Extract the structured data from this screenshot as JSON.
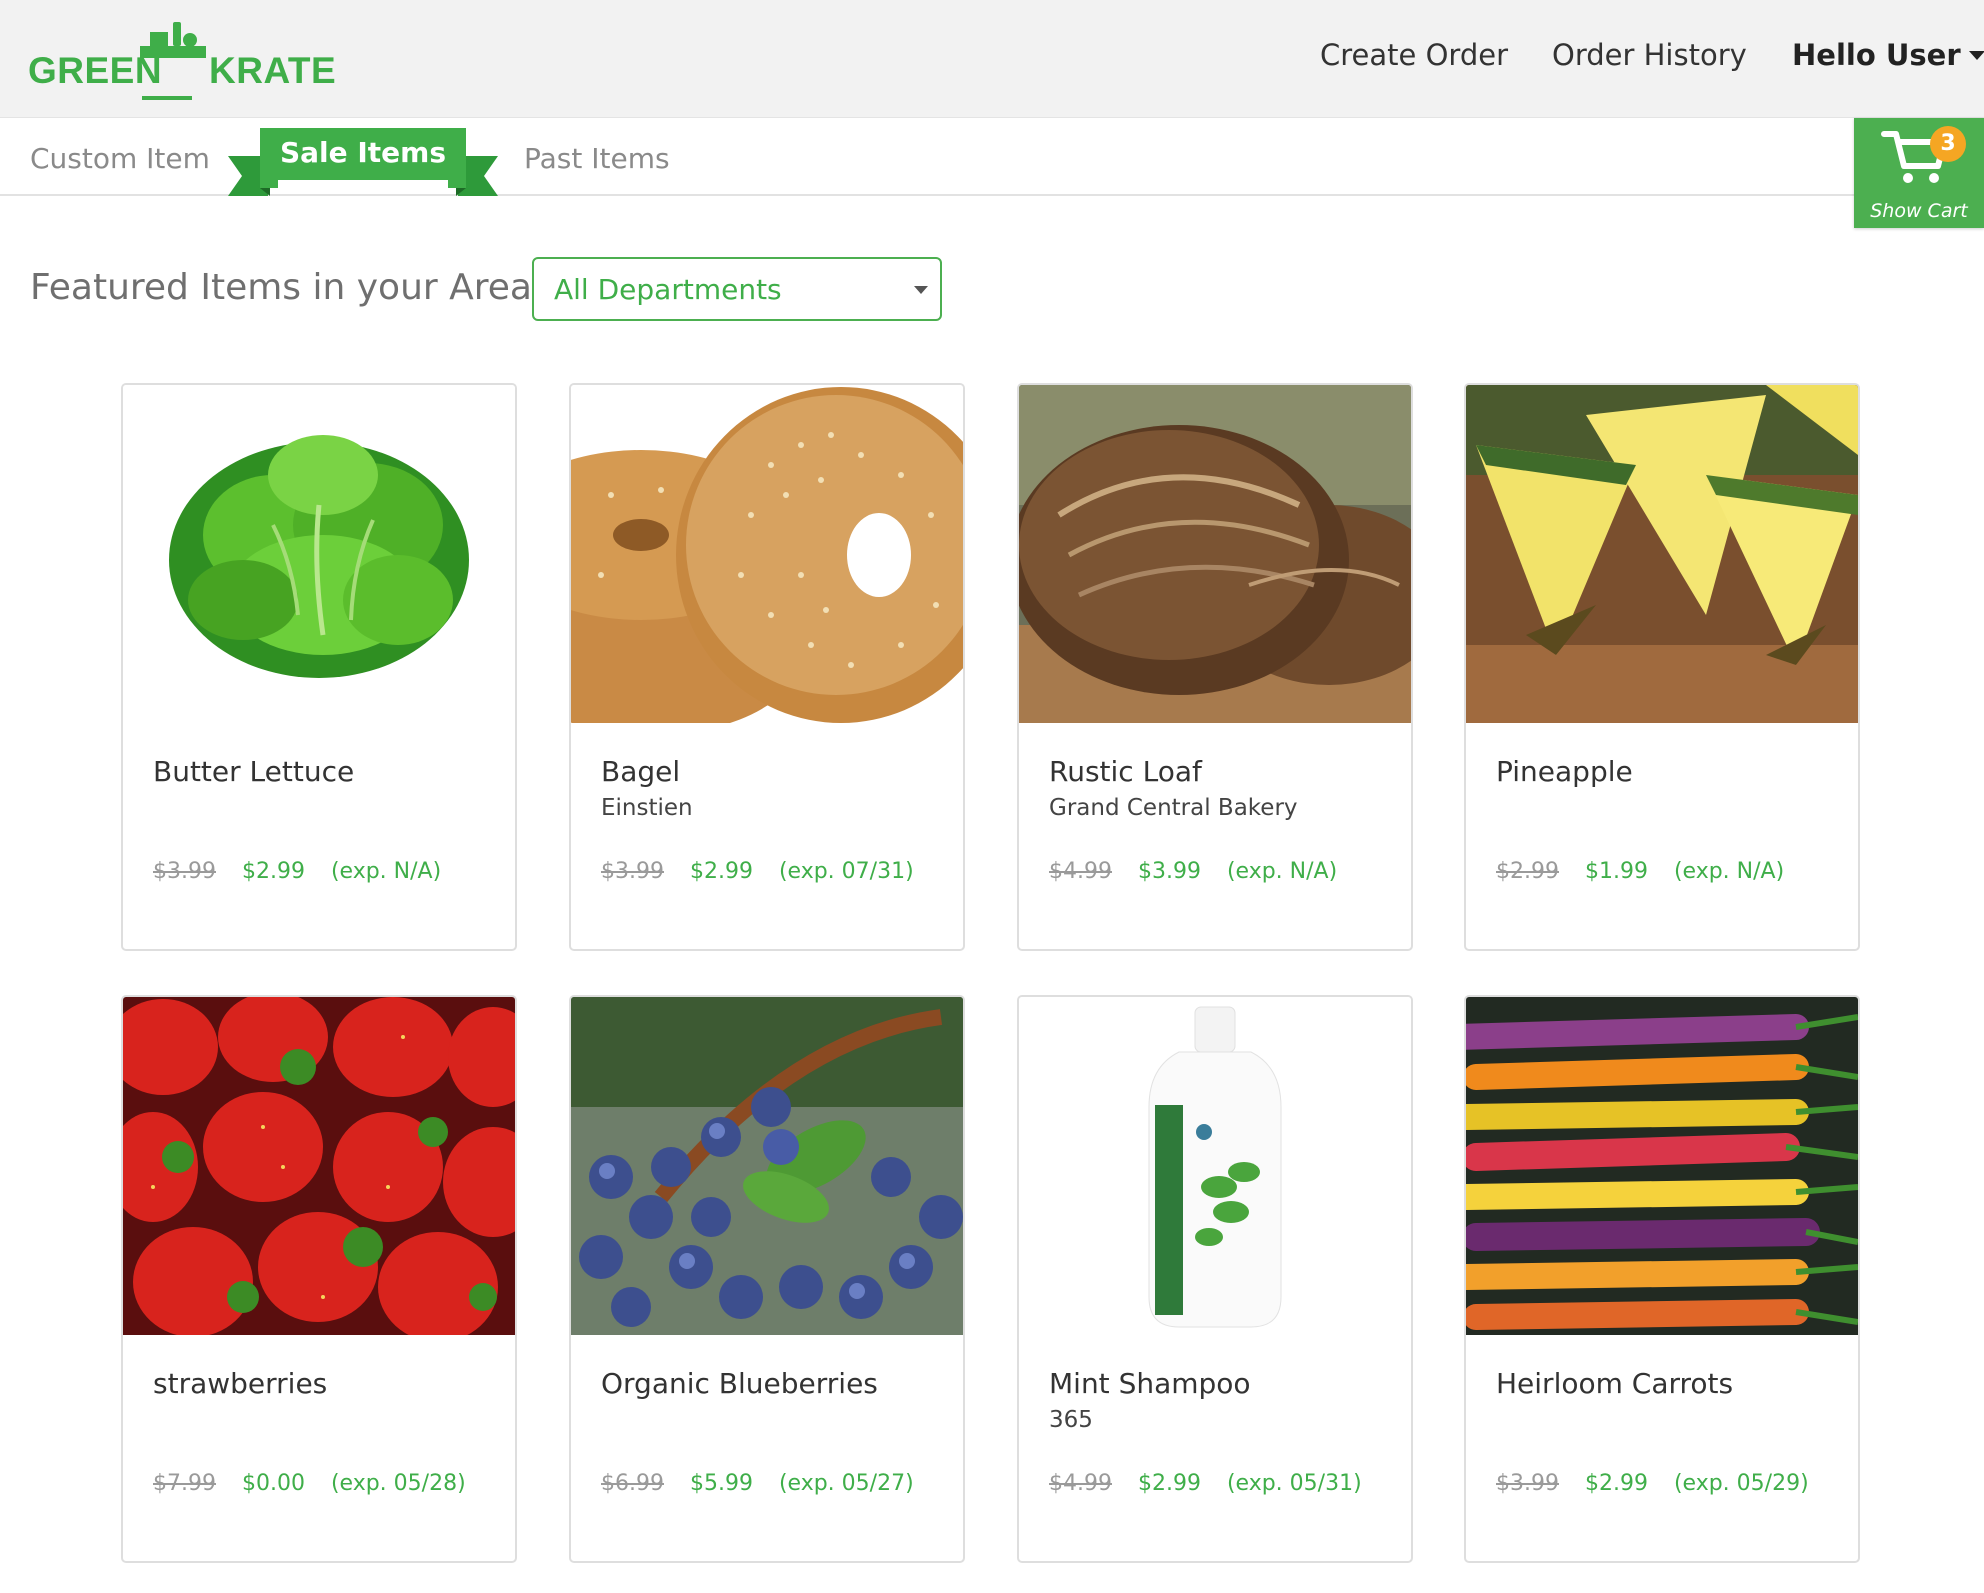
{
  "brand": {
    "logo_left": "GREEN",
    "logo_right": "KRATE"
  },
  "header": {
    "nav": {
      "create_order": "Create Order",
      "order_history": "Order History",
      "user": "Hello User"
    }
  },
  "tabs": {
    "custom": "Custom Item",
    "sale": "Sale Items",
    "past": "Past Items"
  },
  "cart": {
    "count": "3",
    "label": "Show Cart"
  },
  "main": {
    "section_title": "Featured Items in your Area",
    "department_selected": "All Departments"
  },
  "colors": {
    "brand_green": "#3fae49",
    "cart_bg": "#4caf50",
    "badge": "#f5a623"
  },
  "products": [
    {
      "name": "Butter Lettuce",
      "brand": "",
      "old_price": "$3.99",
      "new_price": "$2.99",
      "exp": "(exp. N/A)",
      "image": "lettuce-photo"
    },
    {
      "name": "Bagel",
      "brand": "Einstien",
      "old_price": "$3.99",
      "new_price": "$2.99",
      "exp": "(exp. 07/31)",
      "image": "bagel-photo"
    },
    {
      "name": "Rustic Loaf",
      "brand": "Grand Central Bakery",
      "old_price": "$4.99",
      "new_price": "$3.99",
      "exp": "(exp. N/A)",
      "image": "bread-photo"
    },
    {
      "name": "Pineapple",
      "brand": "",
      "old_price": "$2.99",
      "new_price": "$1.99",
      "exp": "(exp. N/A)",
      "image": "pineapple-photo"
    },
    {
      "name": "strawberries",
      "brand": "",
      "old_price": "$7.99",
      "new_price": "$0.00",
      "exp": "(exp. 05/28)",
      "image": "strawberries-photo"
    },
    {
      "name": "Organic Blueberries",
      "brand": "",
      "old_price": "$6.99",
      "new_price": "$5.99",
      "exp": "(exp. 05/27)",
      "image": "blueberries-photo"
    },
    {
      "name": "Mint Shampoo",
      "brand": "365",
      "old_price": "$4.99",
      "new_price": "$2.99",
      "exp": "(exp. 05/31)",
      "image": "shampoo-photo"
    },
    {
      "name": "Heirloom Carrots",
      "brand": "",
      "old_price": "$3.99",
      "new_price": "$2.99",
      "exp": "(exp. 05/29)",
      "image": "carrots-photo"
    }
  ]
}
